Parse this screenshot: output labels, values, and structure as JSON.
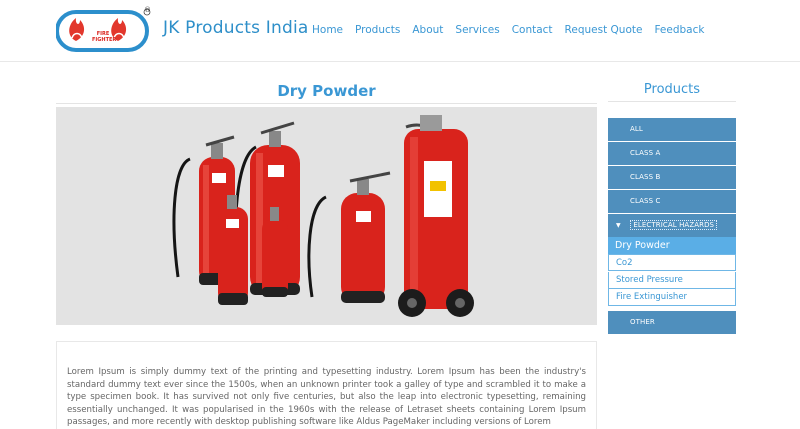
{
  "header": {
    "brand": "JK Products India",
    "logo_text": "FIRE FIGHTER",
    "logo_mark": "®",
    "nav": [
      "Home",
      "Products",
      "About",
      "Services",
      "Contact",
      "Request Quote",
      "Feedback"
    ]
  },
  "main": {
    "title": "Dry Powder",
    "hero_alt": "",
    "body": "Lorem Ipsum is simply dummy text of the printing and typesetting industry. Lorem Ipsum has been the industry's standard dummy text ever since the 1500s, when an unknown printer took a galley of type and scrambled it to make a type specimen book. It has survived not only five centuries, but also the leap into electronic typesetting, remaining essentially unchanged. It was popularised in the 1960s with the release of Letraset sheets containing Lorem Ipsum passages, and more recently with desktop publishing software like Aldus PageMaker including versions of Lorem"
  },
  "sidebar": {
    "title": "Products",
    "items": [
      "ALL",
      "CLASS A",
      "CLASS B",
      "CLASS C"
    ],
    "active": "ELECTRICAL HAZARDS",
    "active_caret": "▼",
    "sub_head": "Dry Powder",
    "sub_items": [
      "Co2",
      "Stored Pressure",
      "Fire Extinguisher"
    ],
    "last": "OTHER"
  },
  "colors": {
    "accent": "#3a97d4",
    "sidebar_bg": "#4f8fbd",
    "sub_head_bg": "#5aaee6",
    "extinguisher_red": "#d9231c"
  }
}
